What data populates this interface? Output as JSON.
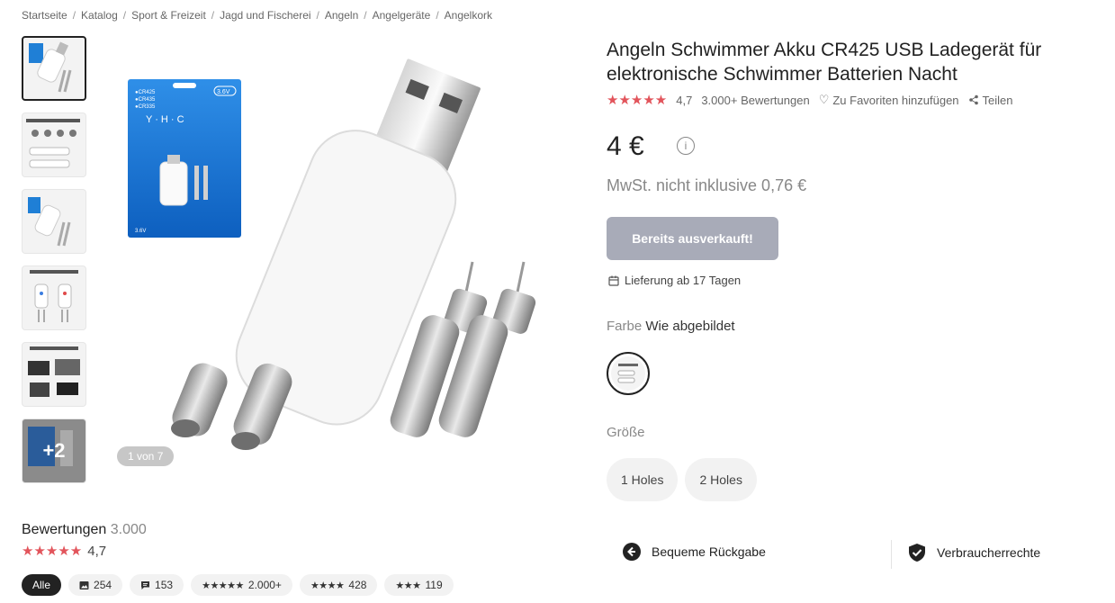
{
  "breadcrumb": [
    "Startseite",
    "Katalog",
    "Sport & Freizeit",
    "Jagd und Fischerei",
    "Angeln",
    "Angelgeräte",
    "Angelkork"
  ],
  "gallery": {
    "more_label": "+2",
    "counter": "1 von 7"
  },
  "product": {
    "title": "Angeln Schwimmer Akku CR425 USB Ladegerät für elektronische Schwimmer Batterien Nacht",
    "rating": "4,7",
    "reviews_link": "3.000+ Bewertungen",
    "favorite_label": "Zu Favoriten hinzufügen",
    "share_label": "Teilen",
    "price": "4 €",
    "vat_note": "MwSt. nicht inklusive 0,76 €",
    "soldout_button": "Bereits ausverkauft!",
    "delivery": "Lieferung ab 17 Tagen",
    "color_label": "Farbe",
    "color_value": "Wie abgebildet",
    "size_label": "Größe",
    "sizes": [
      "1 Holes",
      "2 Holes"
    ]
  },
  "package_text": {
    "brand": "Y · H · C",
    "voltage": "3.6V"
  },
  "reviews": {
    "heading": "Bewertungen",
    "count": "3.000",
    "rating": "4,7",
    "filters": {
      "all": "Alle",
      "photos": "254",
      "comments": "153",
      "five_star": "2.000+",
      "four_star": "428",
      "three_star": "119"
    }
  },
  "features": {
    "returns": "Bequeme Rückgabe",
    "consumer": "Verbraucherrechte"
  },
  "colors": {
    "star": "#e2545b",
    "button_disabled": "#a8abb8"
  }
}
